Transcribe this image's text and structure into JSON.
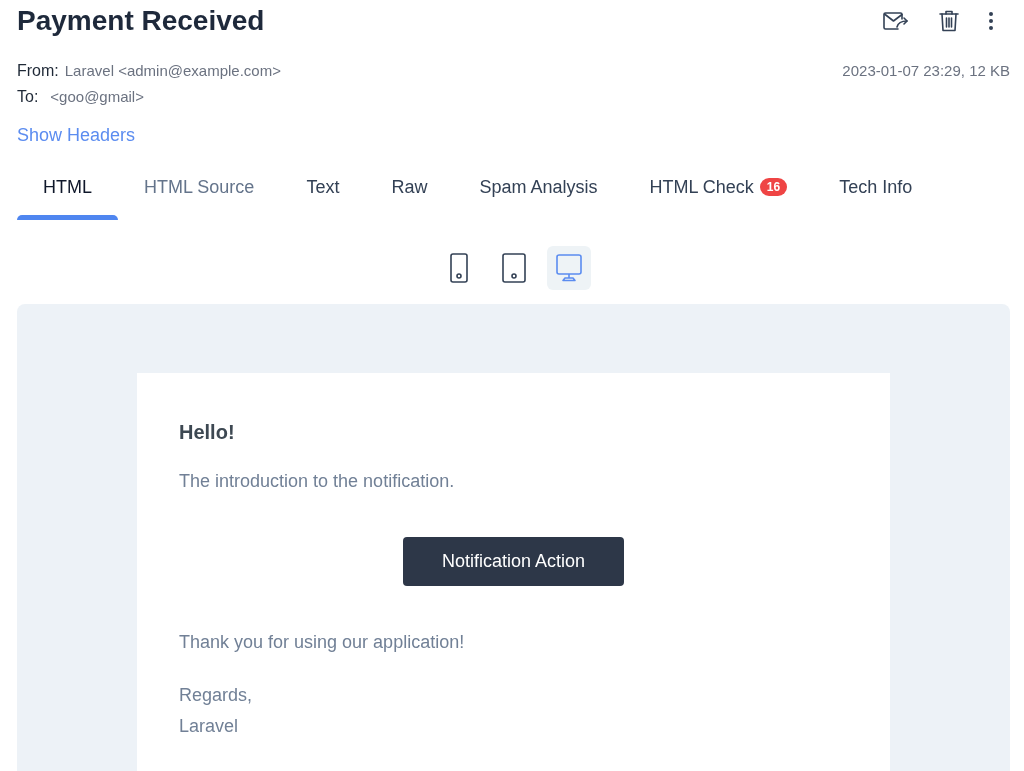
{
  "header": {
    "title": "Payment Received"
  },
  "meta": {
    "from_label": "From:",
    "from": "Laravel <admin@example.com>",
    "to_label": "To:",
    "to": "<goo@gmail>",
    "date_size": "2023-01-07 23:29, 12 KB"
  },
  "show_headers": "Show Headers",
  "tabs": [
    {
      "label": "HTML",
      "selected": true,
      "hovered": false
    },
    {
      "label": "HTML Source",
      "selected": false,
      "hovered": true
    },
    {
      "label": "Text",
      "selected": false,
      "hovered": false
    },
    {
      "label": "Raw",
      "selected": false,
      "hovered": false
    },
    {
      "label": "Spam Analysis",
      "selected": false,
      "hovered": false
    },
    {
      "label": "HTML Check",
      "badge": "16",
      "selected": false,
      "hovered": false
    },
    {
      "label": "Tech Info",
      "selected": false,
      "hovered": false
    }
  ],
  "device_toggles": [
    {
      "kind": "phone",
      "selected": false
    },
    {
      "kind": "tablet",
      "selected": false
    },
    {
      "kind": "desktop",
      "selected": true
    }
  ],
  "email": {
    "greeting": "Hello!",
    "intro": "The introduction to the notification.",
    "action": "Notification Action",
    "outro": "Thank you for using our application!",
    "salutation": "Regards,",
    "signature": "Laravel"
  }
}
